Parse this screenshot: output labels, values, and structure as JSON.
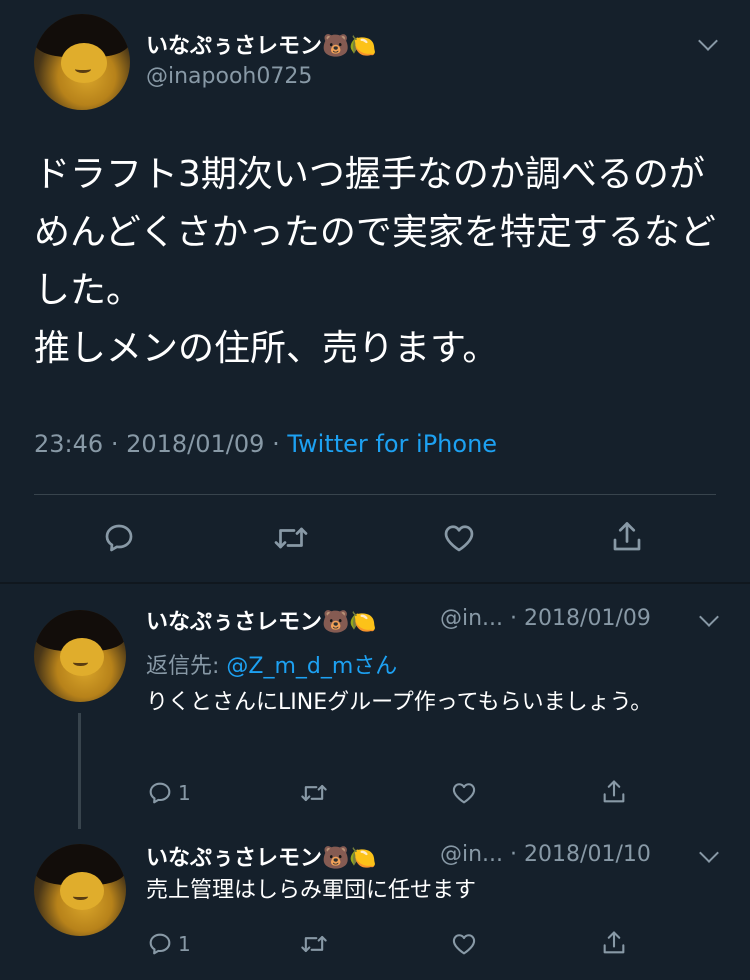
{
  "main_tweet": {
    "display_name": "いなぷぅさレモン",
    "emoji": "🐻🍋",
    "handle": "@inapooh0725",
    "text": "ドラフト3期次いつ握手なのか調べるのがめんどくさかったので実家を特定するなどした。\n推しメンの住所、売ります。",
    "time": "23:46",
    "date": "2018/01/09",
    "source": "Twitter for iPhone",
    "sep": "·"
  },
  "replies": [
    {
      "display_name": "いなぷぅさレモン",
      "emoji": "🐻🍋",
      "handle_trunc": "@in...",
      "date": "2018/01/09",
      "reply_to_label": "返信先: ",
      "reply_to_mention": "@Z_m_d_mさん",
      "text": "りくとさんにLINEグループ作ってもらいましょう。",
      "reply_count": "1"
    },
    {
      "display_name": "いなぷぅさレモン",
      "emoji": "🐻🍋",
      "handle_trunc": "@in...",
      "date": "2018/01/10",
      "text": "売上管理はしらみ軍団に任せます",
      "reply_count": "1"
    }
  ],
  "colors": {
    "background": "#15202b",
    "accent": "#1da1f2",
    "muted": "#8899a6",
    "divider": "#38444d"
  },
  "icons": [
    "reply-icon",
    "retweet-icon",
    "like-icon",
    "share-icon",
    "chevron-down-icon"
  ]
}
